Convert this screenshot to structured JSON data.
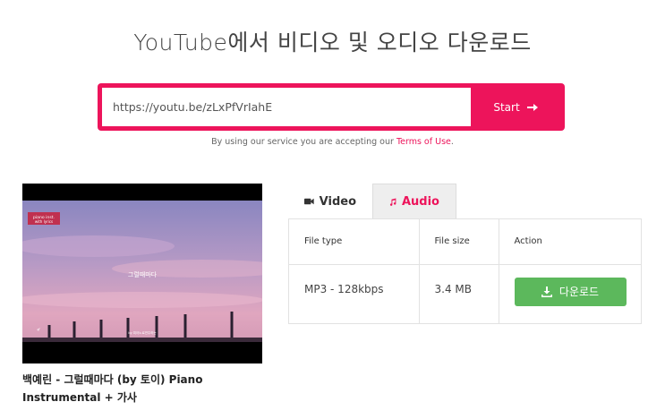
{
  "header": {
    "title": "YouTube에서 비디오 및 오디오 다운로드"
  },
  "search": {
    "value": "https://youtu.be/zLxPfVrIahE",
    "start_label": "Start"
  },
  "terms": {
    "prefix": "By using our service you are accepting our ",
    "link": "Terms of Use",
    "suffix": "."
  },
  "video": {
    "title": "백예린 - 그럴때마다 (by 토이) Piano Instrumental + 가사",
    "thumbnail": {
      "badge_line1": "piano inst.",
      "badge_line2": "with lyrics",
      "center_text": "그럴때마다",
      "caption": "by 피아노로연주하는"
    }
  },
  "tabs": {
    "video_label": "Video",
    "audio_label": "Audio"
  },
  "table": {
    "headers": [
      "File type",
      "File size",
      "Action"
    ],
    "rows": [
      {
        "type": "MP3 - 128kbps",
        "size": "3.4 MB",
        "action": "다운로드"
      }
    ]
  },
  "colors": {
    "accent": "#ed145b",
    "download": "#5cb85c"
  }
}
